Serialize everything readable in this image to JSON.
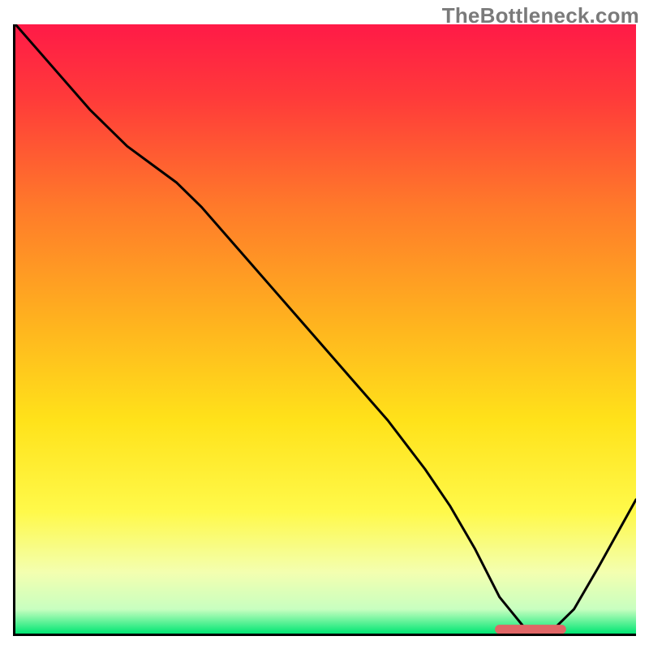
{
  "watermark": "TheBottleneck.com",
  "chart_data": {
    "type": "line",
    "title": "",
    "xlabel": "",
    "ylabel": "",
    "xlim": [
      0,
      100
    ],
    "ylim": [
      0,
      100
    ],
    "series": [
      {
        "name": "bottleneck-curve",
        "x": [
          0,
          6,
          12,
          18,
          22,
          26,
          30,
          36,
          42,
          48,
          54,
          60,
          66,
          70,
          74,
          78,
          82,
          86,
          90,
          94,
          100
        ],
        "y": [
          100,
          93,
          86,
          80,
          77,
          74,
          70,
          63,
          56,
          49,
          42,
          35,
          27,
          21,
          14,
          6,
          1,
          0,
          4,
          11,
          22
        ]
      }
    ],
    "marker": {
      "name": "optimal-marker",
      "color": "#e06666",
      "x_start": 78,
      "x_end": 88,
      "y": 0.7,
      "thickness": 1.6
    },
    "curve_style": {
      "stroke": "#000000",
      "stroke_width": 0.45
    }
  }
}
